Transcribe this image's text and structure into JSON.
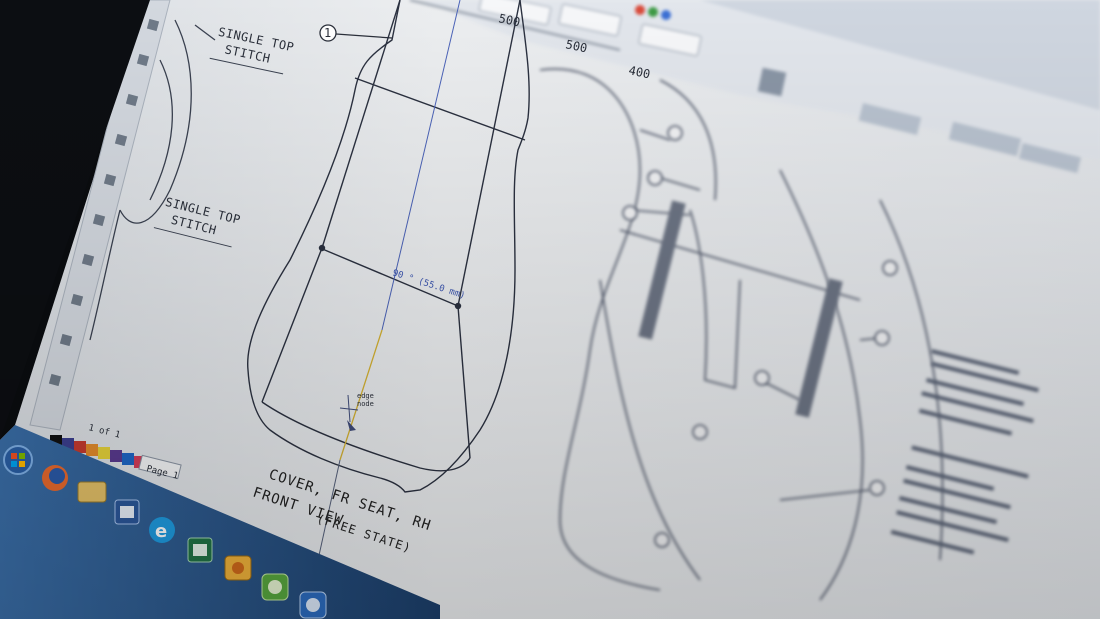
{
  "photo": {
    "subject": "monitor",
    "colors": {
      "screen_paper": "#e9ebee",
      "line": "#2e3440",
      "taskbar": "#1f4f86",
      "toolbar": "#dfe3ea"
    }
  },
  "drawing": {
    "callout_number": "1",
    "stitch_note_top": [
      "SINGLE TOP",
      "STITCH"
    ],
    "stitch_note_mid": [
      "SINGLE TOP",
      "STITCH"
    ],
    "dimension_label": "90 ° (55.0 mm)",
    "cursor_tooltip": [
      "edge",
      "node"
    ],
    "caption_line1": "COVER, FR SEAT, RH",
    "caption_line2": "FRONT VIEW",
    "caption_line3": "(FREE STATE)"
  },
  "toolbar": {
    "ruler_label_1": "500",
    "ruler_label_2": "500",
    "ruler_label_3": "400"
  },
  "status": {
    "page_counter": "1 of 1",
    "page_tab": "Page 1"
  },
  "taskbar": {
    "icons": [
      "windows-start-icon",
      "firefox-icon",
      "file-explorer-icon",
      "word-icon",
      "internet-explorer-icon",
      "excel-icon",
      "outlook-icon",
      "green-app-icon",
      "blue-app-icon"
    ]
  }
}
